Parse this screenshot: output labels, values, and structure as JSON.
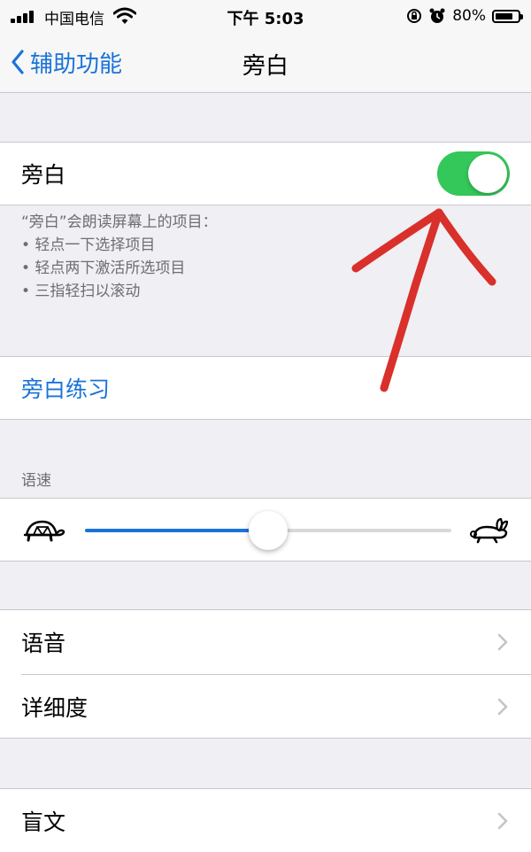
{
  "status_bar": {
    "carrier": "中国电信",
    "time": "下午 5:03",
    "battery": "80%",
    "battery_level": 0.8
  },
  "nav": {
    "back_label": "辅助功能",
    "title": "旁白"
  },
  "voiceover": {
    "label": "旁白",
    "enabled": true,
    "description": [
      "“旁白”会朗读屏幕上的项目：",
      "• 轻点一下选择项目",
      "• 轻点两下激活所选项目",
      "• 三指轻扫以滚动"
    ]
  },
  "practice": {
    "label": "旁白练习"
  },
  "speaking_rate": {
    "header": "语速",
    "value": 0.5,
    "min_icon": "turtle-icon",
    "max_icon": "rabbit-icon"
  },
  "settings_rows": [
    {
      "label": "语音"
    },
    {
      "label": "详细度"
    },
    {
      "label": "盲文"
    }
  ],
  "colors": {
    "accent": "#1a73d9",
    "toggle_on": "#34c759",
    "annotation": "#d9302b"
  }
}
